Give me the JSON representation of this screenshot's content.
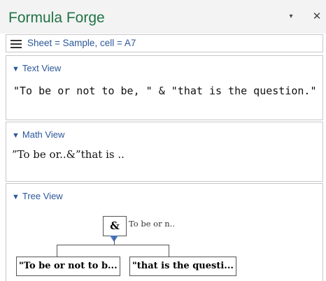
{
  "app": {
    "title": "Formula Forge",
    "dropdown_glyph": "▾",
    "close_glyph": "✕"
  },
  "header": {
    "label": "Sheet = Sample, cell = A7"
  },
  "sections": {
    "text_view": {
      "title": "Text View",
      "content": "\"To be or not to be, \" & \"that is the question.\""
    },
    "math_view": {
      "title": "Math View",
      "content": "”To be or..&”that is .."
    },
    "tree_view": {
      "title": "Tree View",
      "root_label": "&",
      "root_annotation": "To be or n..",
      "children": [
        {
          "label": "\"To be or not to b..."
        },
        {
          "label": "\"that is the questi..."
        }
      ]
    }
  },
  "icons": {
    "collapse": "triangle-down-icon",
    "menu": "hamburger-icon"
  },
  "colors": {
    "title": "#217346",
    "link": "#2b579a",
    "marker": "#4a77c2"
  }
}
